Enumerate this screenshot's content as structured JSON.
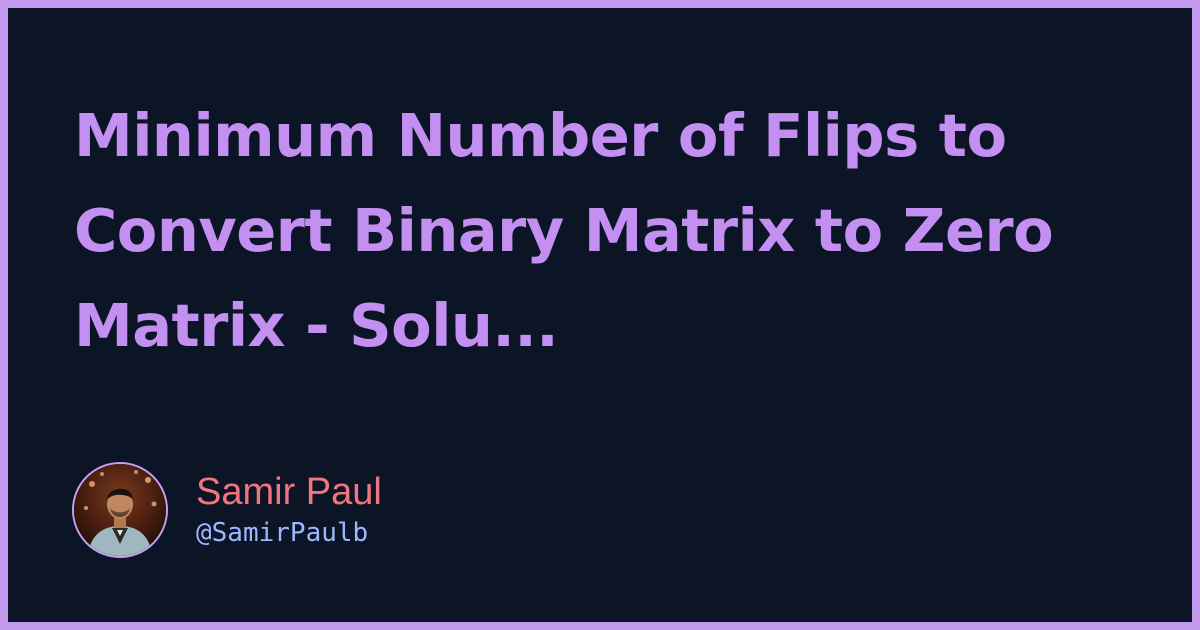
{
  "title": "Minimum Number of Flips to Convert Binary Matrix to Zero Matrix - Solu...",
  "author": {
    "name": "Samir Paul",
    "handle": "@SamirPaulb",
    "avatar_icon": "author-photo"
  },
  "colors": {
    "background": "#0b1526",
    "border": "#c399ee",
    "title": "#c38ff0",
    "name": "#f2747e",
    "handle": "#9fb7ff"
  }
}
